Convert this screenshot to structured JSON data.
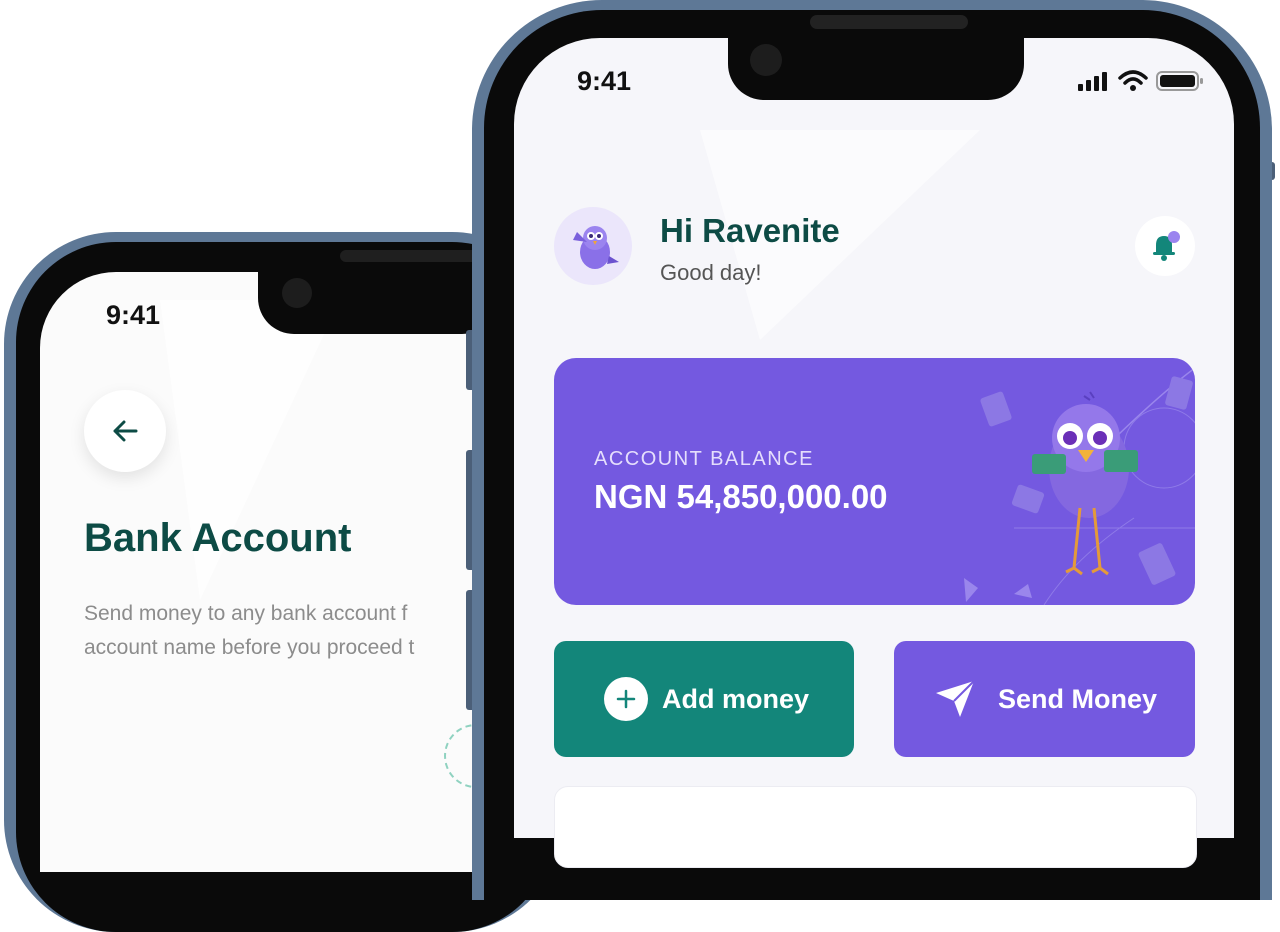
{
  "back_screen": {
    "time": "9:41",
    "back_button_icon": "arrow-left-icon",
    "title": "Bank Account",
    "description_line1": "Send money to any bank account f",
    "description_line2": "account name before you proceed t"
  },
  "front_screen": {
    "time": "9:41",
    "status_icons": [
      "signal-icon",
      "wifi-icon",
      "battery-icon"
    ],
    "header": {
      "greeting": "Hi Ravenite",
      "sub_greeting": "Good day!",
      "avatar_icon": "bird-mascot-icon",
      "notification_icon": "bell-icon"
    },
    "balance_card": {
      "label": "ACCOUNT BALANCE",
      "value": "NGN 54,850,000.00"
    },
    "actions": {
      "add_money": "Add money",
      "send_money": "Send Money"
    }
  },
  "colors": {
    "brand_green": "#0d4b45",
    "action_green": "#13867a",
    "brand_purple": "#7459e0",
    "phone_frame": "#5e7896"
  }
}
